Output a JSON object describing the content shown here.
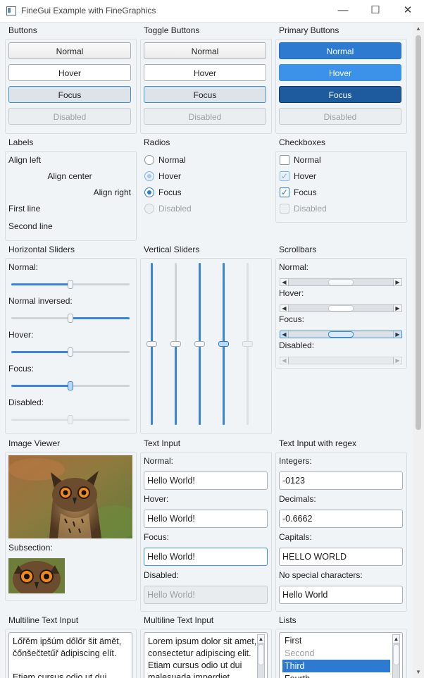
{
  "window": {
    "title": "FineGui Example with FineGraphics",
    "minimize": "—",
    "maximize": "☐",
    "close": "✕"
  },
  "sections": {
    "buttons": "Buttons",
    "toggle_buttons": "Toggle Buttons",
    "primary_buttons": "Primary Buttons",
    "labels": "Labels",
    "radios": "Radios",
    "checkboxes": "Checkboxes",
    "horizontal_sliders": "Horizontal Sliders",
    "vertical_sliders": "Vertical Sliders",
    "scrollbars": "Scrollbars",
    "image_viewer": "Image Viewer",
    "text_input": "Text Input",
    "text_input_regex": "Text Input with regex",
    "multiline_1": "Multiline Text Input",
    "multiline_2": "Multiline Text Input",
    "lists": "Lists"
  },
  "states": {
    "normal": "Normal",
    "hover": "Hover",
    "focus": "Focus",
    "disabled": "Disabled"
  },
  "labels": {
    "align_left": "Align left",
    "align_center": "Align center",
    "align_right": "Align right",
    "first_line": "First line",
    "second_line": "Second line"
  },
  "checkboxes": {
    "hover_checked": true,
    "focus_checked": true,
    "check_glyph": "✓"
  },
  "hsliders": {
    "normal_label": "Normal:",
    "inversed_label": "Normal inversed:",
    "hover_label": "Hover:",
    "focus_label": "Focus:",
    "disabled_label": "Disabled:",
    "value_fraction": 0.5
  },
  "vsliders": {
    "values": [
      1.0,
      0.0,
      1.0,
      1.0,
      0.5
    ],
    "thumb_fraction": 0.5
  },
  "scrollbars": {
    "normal_label": "Normal:",
    "hover_label": "Hover:",
    "focus_label": "Focus:",
    "disabled_label": "Disabled:",
    "left_arrow": "◀",
    "right_arrow": "▶"
  },
  "image_viewer": {
    "subsection_label": "Subsection:"
  },
  "text_input": {
    "normal_label": "Normal:",
    "hover_label": "Hover:",
    "focus_label": "Focus:",
    "disabled_label": "Disabled:",
    "value": "Hello World!"
  },
  "regex_input": {
    "integers_label": "Integers:",
    "integers_value": "-0123",
    "decimals_label": "Decimals:",
    "decimals_value": "-0.6662",
    "capitals_label": "Capitals:",
    "capitals_value": "HELLO WORLD",
    "nospecial_label": "No special characters:",
    "nospecial_value": "Hello World"
  },
  "multiline": {
    "text1": "Lőřěm ipšúm dőlőr šit ämět,\nčőnšečtetűř ädipiscing elít.\n\nEtiam cursus odio ut dui",
    "text2": "Lorem ipsum dolor sit amet,\nconsectetur adipiscing elit.\nEtiam cursus odio ut dui\nmalesuada imperdiet",
    "up_arrow": "▲"
  },
  "list": {
    "items": [
      "First",
      "Second",
      "Third",
      "Fourth"
    ],
    "up_arrow": "▲"
  },
  "window_scroll": {
    "up": "▲",
    "down": "▼"
  },
  "colors": {
    "accent": "#2c7bd0",
    "accent_hover": "#3b92e8",
    "accent_pressed": "#1d5b9e",
    "background": "#f0f4f7"
  }
}
